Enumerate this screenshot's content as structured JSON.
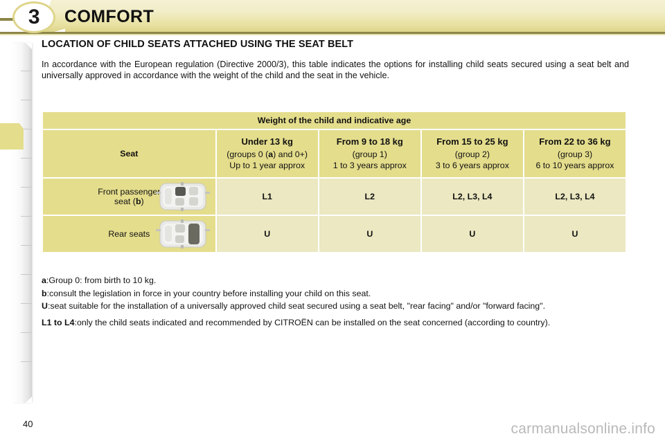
{
  "banner": {
    "chapter_number": "3",
    "title": "COMFORT",
    "accent_color": "#e4dd8c",
    "rule_color": "#8c8549"
  },
  "content": {
    "section_title": "LOCATION OF CHILD SEATS ATTACHED USING THE SEAT BELT",
    "intro": "In accordance with the European regulation (Directive 2000/3), this table indicates the options for installing child seats secured using a seat belt and universally approved in accordance with the weight of the child and the seat in the vehicle."
  },
  "table": {
    "span_header": "Weight of the child and indicative age",
    "seat_header": "Seat",
    "columns": [
      {
        "weight": "Under 13 kg",
        "group": "(groups 0 (a) and 0+)",
        "group_pre": "(groups 0 (",
        "group_bold": "a",
        "group_post": ") and 0+)",
        "age": "Up to 1 year approx"
      },
      {
        "weight": "From 9 to 18 kg",
        "group": "(group 1)",
        "age": "1 to 3 years approx"
      },
      {
        "weight": "From 15 to 25 kg",
        "group": "(group 2)",
        "age": "3 to 6 years approx"
      },
      {
        "weight": "From 22 to 36 kg",
        "group": "(group 3)",
        "age": "6 to 10 years approx"
      }
    ],
    "rows": [
      {
        "label_line1": "Front passenger",
        "label_line2_pre": "seat (",
        "label_line2_bold": "b",
        "label_line2_post": ")",
        "icon": "car-top-view-front-seat-icon",
        "values": [
          "L1",
          "L2",
          "L2, L3, L4",
          "L2, L3, L4"
        ]
      },
      {
        "label_line1": "Rear seats",
        "label_line2_pre": "",
        "label_line2_bold": "",
        "label_line2_post": "",
        "icon": "car-top-view-rear-seats-icon",
        "values": [
          "U",
          "U",
          "U",
          "U"
        ]
      }
    ],
    "header_bg": "#e4dd8c",
    "cell_bg": "#ebe8c2"
  },
  "notes": [
    {
      "key": "a",
      "sep": ": ",
      "text": "Group 0: from birth to 10 kg."
    },
    {
      "key": "b",
      "sep": ": ",
      "text": "consult the legislation in force in your country before installing your child on this seat."
    },
    {
      "key": "U",
      "sep": ": ",
      "text": "seat suitable for the installation of a universally approved child seat secured using a seat belt, \"rear facing\" and/or \"forward facing\"."
    },
    {
      "key": "L1 to L4",
      "sep": ": ",
      "text": "only the child seats indicated and recommended by CITROËN can be installed on the seat concerned (according to country)."
    }
  ],
  "footer": {
    "page_number": "40",
    "watermark": "carmanualsonline.info"
  }
}
